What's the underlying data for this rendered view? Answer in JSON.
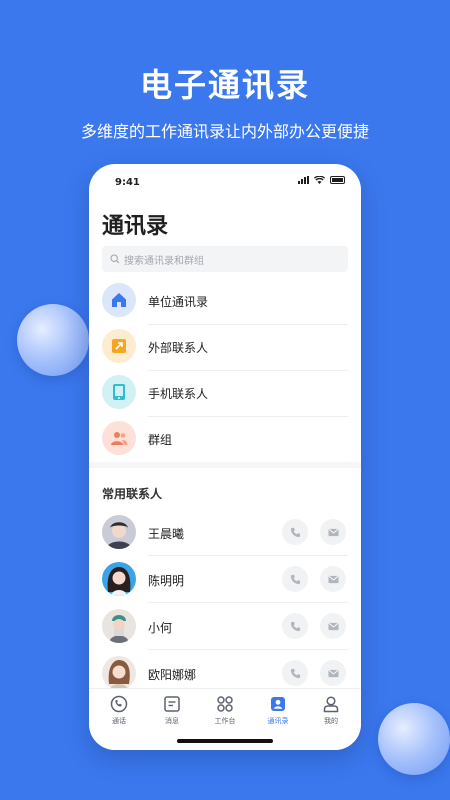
{
  "hero": {
    "title": "电子通讯录",
    "subtitle": "多维度的工作通讯录让内外部办公更便捷"
  },
  "phone": {
    "status_time": "9:41",
    "page_title": "通讯录",
    "search_placeholder": "搜索通讯录和群组",
    "menu": [
      {
        "label": "单位通讯录",
        "icon": "home-icon",
        "color": "#3b78ee"
      },
      {
        "label": "外部联系人",
        "icon": "external-link-icon",
        "color": "#f5a623"
      },
      {
        "label": "手机联系人",
        "icon": "phone-device-icon",
        "color": "#2bbfd0"
      },
      {
        "label": "群组",
        "icon": "group-icon",
        "color": "#f07c5c"
      }
    ],
    "section_title": "常用联系人",
    "contacts": [
      {
        "name": "王晨曦"
      },
      {
        "name": "陈明明"
      },
      {
        "name": "小何"
      },
      {
        "name": "欧阳娜娜"
      }
    ],
    "tabs": [
      {
        "label": "通话",
        "icon": "call-icon",
        "active": false
      },
      {
        "label": "消息",
        "icon": "message-icon",
        "active": false
      },
      {
        "label": "工作台",
        "icon": "workbench-icon",
        "active": false
      },
      {
        "label": "通讯录",
        "icon": "contacts-icon",
        "active": true
      },
      {
        "label": "我的",
        "icon": "profile-icon",
        "active": false
      }
    ]
  },
  "colors": {
    "brand": "#3b78ee",
    "background": "#3b78ee"
  }
}
